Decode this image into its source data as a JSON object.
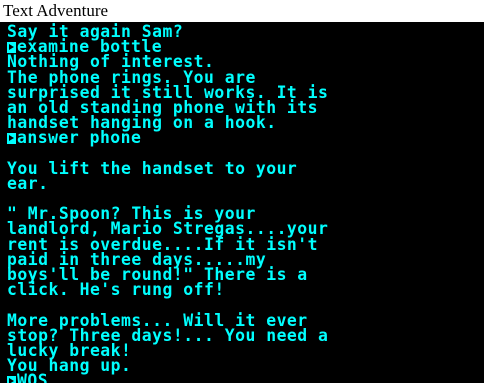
{
  "window": {
    "title": "Text Adventure"
  },
  "transcript": {
    "lines": [
      {
        "text": "Say it again Sam?",
        "is_command": false
      },
      {
        "text": "examine bottle",
        "is_command": true
      },
      {
        "text": "Nothing of interest.",
        "is_command": false
      },
      {
        "text": "The phone rings. You are",
        "is_command": false
      },
      {
        "text": "surprised it still works. It is",
        "is_command": false
      },
      {
        "text": "an old standing phone with its",
        "is_command": false
      },
      {
        "text": "handset hanging on a hook.",
        "is_command": false
      },
      {
        "text": "answer phone",
        "is_command": true
      },
      {
        "text": "",
        "is_command": false
      },
      {
        "text": "You lift the handset to your",
        "is_command": false
      },
      {
        "text": "ear.",
        "is_command": false
      },
      {
        "text": "",
        "is_command": false
      },
      {
        "text": "\" Mr.Spoon? This is your",
        "is_command": false
      },
      {
        "text": "landlord, Mario Stregas....your",
        "is_command": false
      },
      {
        "text": "rent is overdue....If it isn't",
        "is_command": false
      },
      {
        "text": "paid in three days.....my",
        "is_command": false
      },
      {
        "text": "boys'll be round!\" There is a",
        "is_command": false
      },
      {
        "text": "click. He's rung off!",
        "is_command": false
      },
      {
        "text": "",
        "is_command": false
      },
      {
        "text": "More problems... Will it ever",
        "is_command": false
      },
      {
        "text": "stop? Three days!... You need a",
        "is_command": false
      },
      {
        "text": "lucky break!",
        "is_command": false
      },
      {
        "text": "You hang up.",
        "is_command": false
      },
      {
        "text": "WOS",
        "is_command": true
      }
    ]
  },
  "colors": {
    "screen_background": "#000000",
    "text": "#00ffff",
    "window_background": "#ffffff",
    "title_text": "#000000"
  },
  "icons": {
    "prompt": "prompt-arrow-icon"
  }
}
